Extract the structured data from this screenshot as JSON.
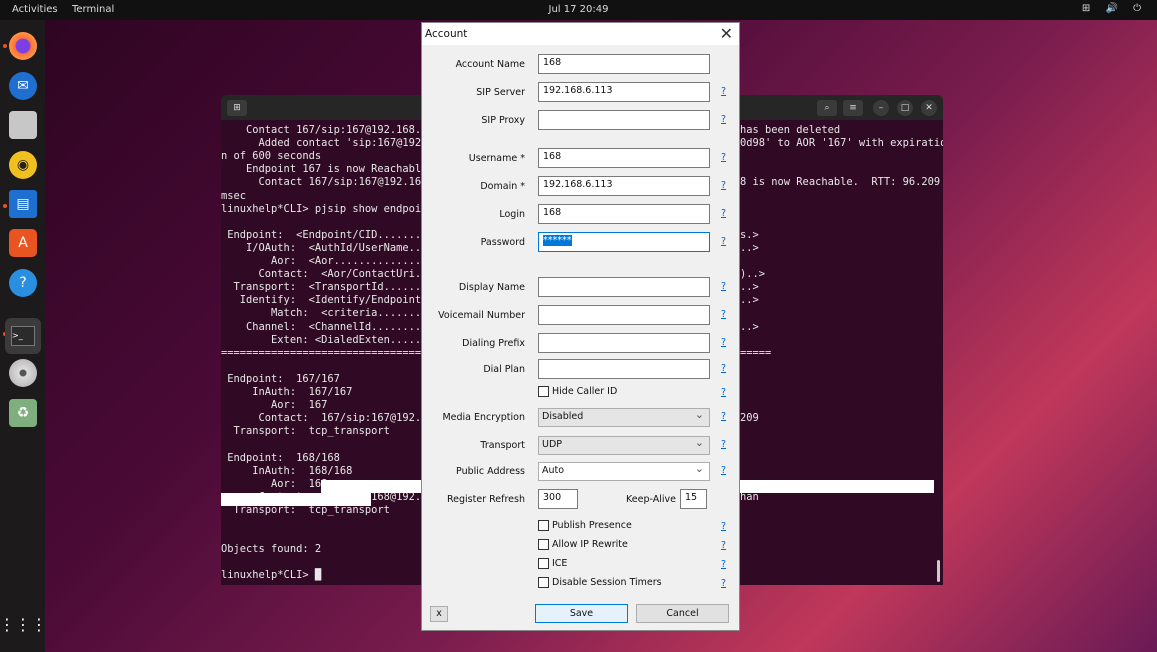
{
  "topbar": {
    "activities": "Activities",
    "app": "Terminal",
    "clock": "Jul 17  20:49",
    "tray": "⊞ 🔊 ⏻"
  },
  "dock": {
    "items": [
      "firefox-icon",
      "thunderbird-icon",
      "files-icon",
      "rhythmbox-icon",
      "writer-icon",
      "app-center-icon",
      "help-icon",
      "terminal-icon",
      "dvd-icon",
      "trash-icon"
    ],
    "grid": "⋮⋮⋮"
  },
  "terminal": {
    "lines": [
      {
        "l": "    Contact 167/sip:167@192.168.6",
        "r": "has been deleted"
      },
      {
        "l": "      Added contact 'sip:167@192",
        "r": "0d98' to AOR '167' with expiratio"
      },
      {
        "l": "n of 600 seconds",
        "r": ""
      },
      {
        "l": "    Endpoint 167 is now Reachable",
        "r": ""
      },
      {
        "l": "      Contact 167/sip:167@192.168",
        "r": "8 is now Reachable.  RTT: 96.209"
      },
      {
        "l": "msec",
        "r": ""
      },
      {
        "l": "linuxhelp*CLI> pjsip show endpoint",
        "r": ""
      },
      {
        "l": "",
        "r": ""
      },
      {
        "l": " Endpoint:  <Endpoint/CID........",
        "r": "s.>"
      },
      {
        "l": "    I/OAuth:  <AuthId/UserName...",
        "r": "..>"
      },
      {
        "l": "        Aor:  <Aor...............",
        "r": ""
      },
      {
        "l": "      Contact:  <Aor/ContactUri..",
        "r": ")..>"
      },
      {
        "l": "  Transport:  <TransportId.......",
        "r": "..>"
      },
      {
        "l": "   Identify:  <Identify/Endpoint.",
        "r": "..>"
      },
      {
        "l": "        Match:  <criteria........",
        "r": ""
      },
      {
        "l": "    Channel:  <ChannelId.........",
        "r": "..>"
      },
      {
        "l": "        Exten: <DialedExten......",
        "r": ""
      },
      {
        "l": "==================================",
        "r": "====="
      },
      {
        "l": "",
        "r": ""
      },
      {
        "l": " Endpoint:  167/167",
        "r": ""
      },
      {
        "l": "     InAuth:  167/167",
        "r": ""
      },
      {
        "l": "        Aor:  167",
        "r": ""
      },
      {
        "l": "      Contact:  167/sip:167@192.16",
        "r": "209"
      },
      {
        "l": "  Transport:  tcp_transport",
        "r": ""
      },
      {
        "l": "",
        "r": ""
      },
      {
        "l": " Endpoint:  168/168",
        "r": ""
      },
      {
        "l": "     InAuth:  168/168",
        "r": ""
      },
      {
        "l": "        Aor:  168",
        "r": ""
      },
      {
        "l": "      Contact:  168/sip:168@192.16",
        "r": "han"
      },
      {
        "l": "  Transport:  tcp_transport",
        "r": ""
      },
      {
        "l": "",
        "r": ""
      },
      {
        "l": "",
        "r": ""
      },
      {
        "l": "Objects found: 2",
        "r": ""
      },
      {
        "l": "",
        "r": ""
      },
      {
        "l": "linuxhelp*CLI> █",
        "r": ""
      }
    ]
  },
  "dialog": {
    "title": "Account",
    "close": "✕",
    "fields": [
      {
        "label": "Account Name",
        "value": "168",
        "help": ""
      },
      {
        "label": "SIP Server",
        "value": "192.168.6.113",
        "help": "?"
      },
      {
        "label": "SIP Proxy",
        "value": "",
        "help": "?"
      },
      {
        "label": "Username *",
        "value": "168",
        "help": "?"
      },
      {
        "label": "Domain *",
        "value": "192.168.6.113",
        "help": "?"
      },
      {
        "label": "Login",
        "value": "168",
        "help": "?"
      },
      {
        "label": "Password",
        "value": "******",
        "help": "?"
      },
      {
        "label": "Display Name",
        "value": "",
        "help": "?"
      },
      {
        "label": "Voicemail Number",
        "value": "",
        "help": "?"
      },
      {
        "label": "Dialing Prefix",
        "value": "",
        "help": "?"
      },
      {
        "label": "Dial Plan",
        "value": "",
        "help": "?"
      }
    ],
    "hide_caller_id": "Hide Caller ID",
    "selects": [
      {
        "label": "Media Encryption",
        "value": "Disabled"
      },
      {
        "label": "Transport",
        "value": "UDP"
      },
      {
        "label": "Public Address",
        "value": "Auto"
      }
    ],
    "register_refresh_label": "Register Refresh",
    "register_refresh": "300",
    "keepalive_label": "Keep-Alive",
    "keepalive": "15",
    "checkboxes": [
      "Publish Presence",
      "Allow IP Rewrite",
      "ICE",
      "Disable Session Timers"
    ],
    "help": "?",
    "x_button": "x",
    "save": "Save",
    "cancel": "Cancel"
  }
}
